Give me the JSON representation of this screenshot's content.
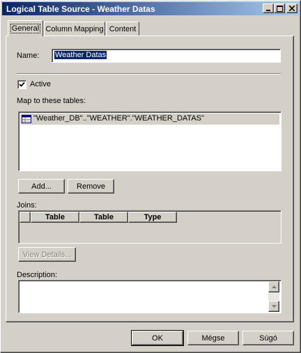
{
  "window": {
    "title": "Logical Table Source - Weather Datas"
  },
  "tabs": [
    {
      "label": "General"
    },
    {
      "label": "Column Mapping"
    },
    {
      "label": "Content"
    }
  ],
  "general": {
    "name_label": "Name:",
    "name_value": "Weather Datas",
    "active_label": "Active",
    "active_checked": true,
    "map_label": "Map to these tables:",
    "tables": [
      {
        "label": "\"Weather_DB\"..\"WEATHER\".\"WEATHER_DATAS\"",
        "icon": "table-icon"
      }
    ],
    "add_label": "Add...",
    "remove_label": "Remove",
    "joins_label": "Joins:",
    "joins_columns": [
      "Table",
      "Table",
      "Type"
    ],
    "view_details_label": "View Details...",
    "description_label": "Description:",
    "description_value": ""
  },
  "footer": {
    "ok_label": "OK",
    "cancel_label": "Mégse",
    "help_label": "Súgó"
  }
}
